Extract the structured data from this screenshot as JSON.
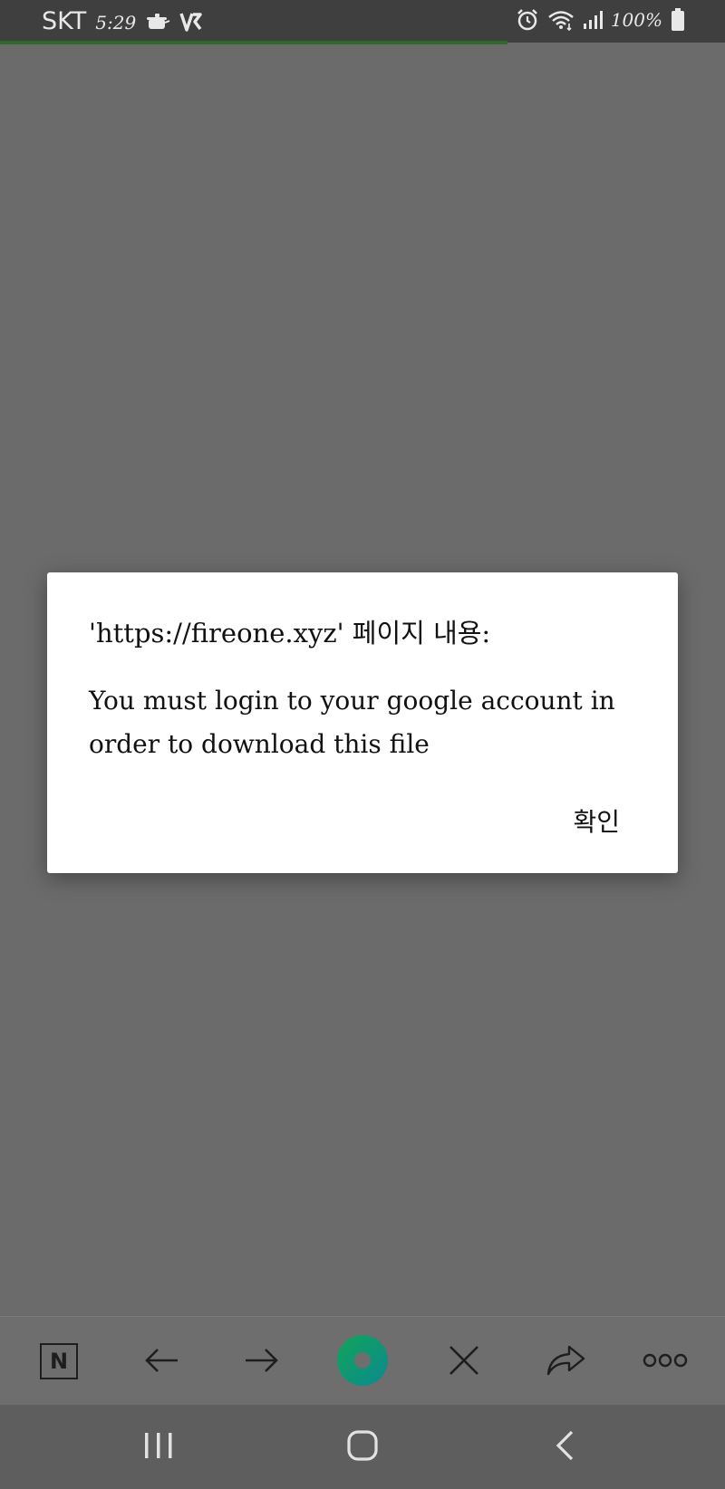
{
  "status_bar": {
    "carrier": "SKT",
    "time": "5:29",
    "battery": "100%",
    "page_load_progress": 0.7,
    "icons": [
      "rice-cooker-icon",
      "v3-antivirus-icon",
      "alarm-icon",
      "wifi-icon",
      "signal-icon",
      "battery-icon"
    ]
  },
  "dialog": {
    "title": "'https://fireone.xyz' 페이지 내용:",
    "message": "You must login to your google account in order to download this file",
    "ok_label": "확인"
  },
  "toolbar": {
    "naver_label": "N",
    "accent_color": "#0e9a6e",
    "icons": [
      "naver-home-icon",
      "back-arrow-icon",
      "forward-arrow-icon",
      "green-dot-icon",
      "close-icon",
      "share-icon",
      "more-icon"
    ]
  },
  "system_nav": {
    "icons": [
      "recent-apps-icon",
      "home-icon",
      "back-icon"
    ]
  }
}
